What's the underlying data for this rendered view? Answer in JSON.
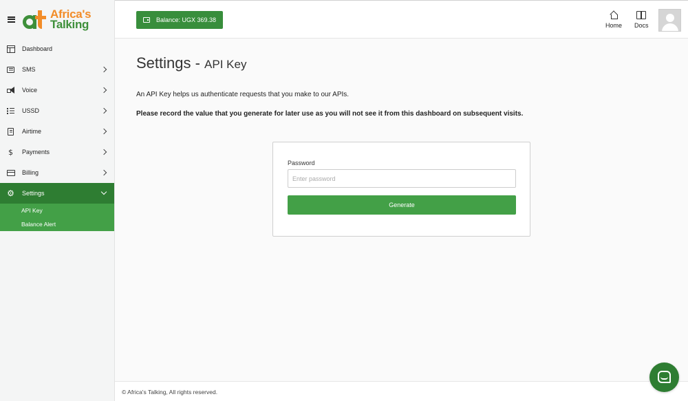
{
  "brand": {
    "line1": "Africa's",
    "line2": "Talking"
  },
  "colors": {
    "primary": "#2e7d32",
    "accent": "#43a047",
    "logo_orange": "#f28c28",
    "logo_green": "#3e8f3a"
  },
  "sidebar": {
    "items": [
      {
        "label": "Dashboard",
        "icon": "dashboard-icon"
      },
      {
        "label": "SMS",
        "icon": "message-icon"
      },
      {
        "label": "Voice",
        "icon": "megaphone-icon"
      },
      {
        "label": "USSD",
        "icon": "list-icon"
      },
      {
        "label": "Airtime",
        "icon": "receipt-icon"
      },
      {
        "label": "Payments",
        "icon": "dollar-icon"
      },
      {
        "label": "Billing",
        "icon": "credit-card-icon"
      },
      {
        "label": "Settings",
        "icon": "gear-icon"
      }
    ],
    "sub_items": [
      {
        "label": "API Key"
      },
      {
        "label": "Balance Alert"
      }
    ]
  },
  "header": {
    "balance_label": "Balance: UGX 369.38",
    "home_label": "Home",
    "docs_label": "Docs"
  },
  "main": {
    "title": "Settings - ",
    "subtitle": "API Key",
    "intro": "An API Key helps us authenticate requests that you make to our APIs.",
    "notice": "Please record the value that you generate for later use as you will not see it from this dashboard on subsequent visits.",
    "form": {
      "password_label": "Password",
      "password_placeholder": "Enter password",
      "generate_label": "Generate"
    }
  },
  "footer": {
    "copyright": "© Africa's Talking, All rights reserved."
  }
}
